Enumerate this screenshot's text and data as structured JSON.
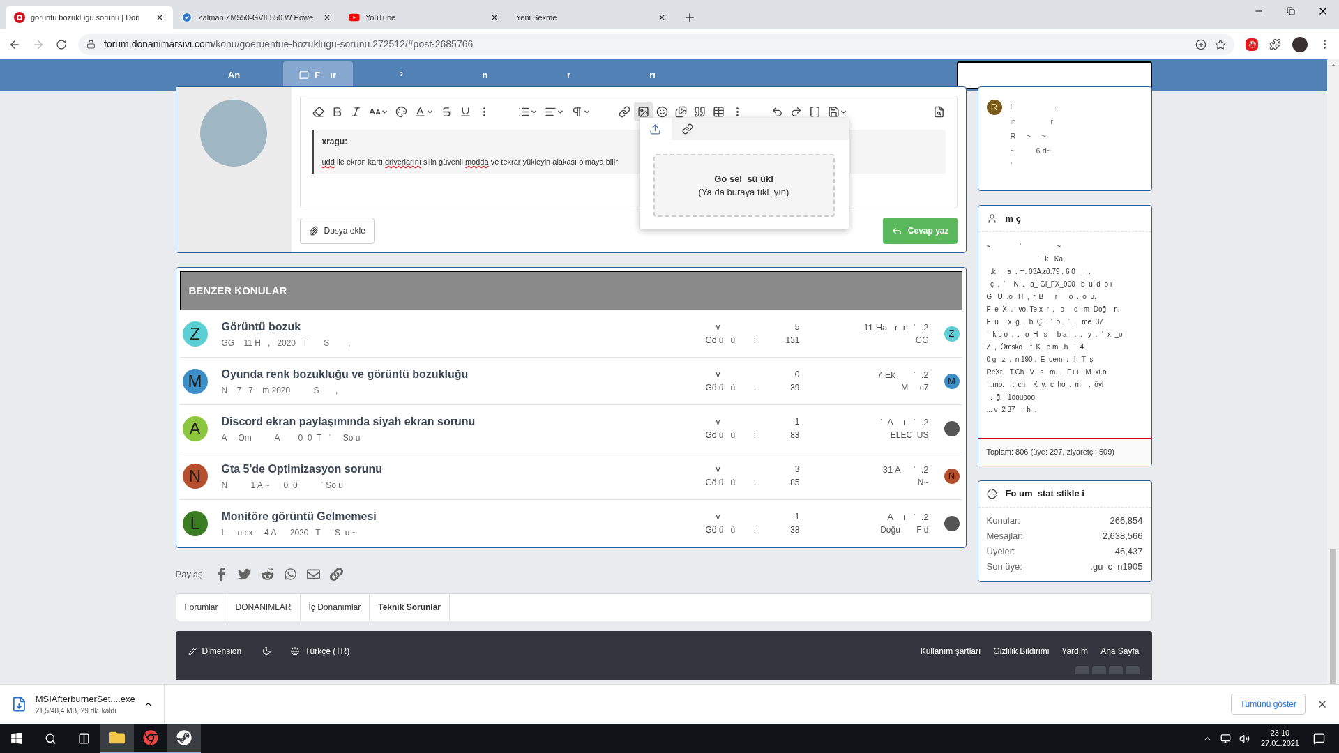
{
  "browser": {
    "tabs": [
      {
        "title": "görüntü bozukluğu sorunu | Don",
        "kind": "site",
        "selected": true
      },
      {
        "title": "Zalman ZM550-GVII 550 W Powe",
        "kind": "check",
        "selected": false
      },
      {
        "title": "YouTube",
        "kind": "video",
        "selected": false
      },
      {
        "title": "Yeni Sekme",
        "kind": "blank",
        "selected": false
      }
    ],
    "url": {
      "host": "forum.donanimarsivi.com",
      "path": "/konu/goeruentue-bozuklugu-sorunu.272512/#post-2685766"
    }
  },
  "nav": {
    "items": [
      {
        "label": "An",
        "selected": false,
        "has_icon": false
      },
      {
        "label": "F    ır",
        "selected": true,
        "has_icon": true
      },
      {
        "label": "ˀ",
        "selected": false,
        "has_icon": false
      },
      {
        "label": "n",
        "selected": false,
        "has_icon": false
      },
      {
        "label": "r",
        "selected": false,
        "has_icon": false
      },
      {
        "label": "rı",
        "selected": false,
        "has_icon": false
      }
    ]
  },
  "editor": {
    "toolbar": [
      {
        "kind": "eraser",
        "selected": false
      },
      {
        "kind": "bold",
        "selected": false
      },
      {
        "kind": "italic",
        "selected": false
      },
      {
        "kind": "size",
        "selected": false
      },
      {
        "kind": "palette",
        "selected": false
      },
      {
        "kind": "color",
        "selected": false
      },
      {
        "kind": "strike",
        "selected": false
      },
      {
        "kind": "underline",
        "selected": false
      },
      {
        "kind": "more",
        "selected": false
      },
      {
        "kind": "list",
        "selected": false
      },
      {
        "kind": "align",
        "selected": false
      },
      {
        "kind": "paragraph",
        "selected": false
      },
      {
        "kind": "link",
        "selected": false
      },
      {
        "kind": "image",
        "selected": true
      },
      {
        "kind": "smile",
        "selected": false
      },
      {
        "kind": "media",
        "selected": false
      },
      {
        "kind": "quote",
        "selected": false
      },
      {
        "kind": "table",
        "selected": false
      },
      {
        "kind": "more",
        "selected": false
      },
      {
        "kind": "undo",
        "selected": false
      },
      {
        "kind": "redo",
        "selected": false
      },
      {
        "kind": "code",
        "selected": false
      },
      {
        "kind": "save",
        "selected": false
      },
      {
        "kind": "preview",
        "selected": false
      }
    ],
    "quote": {
      "author": "xragu:",
      "segments": [
        {
          "text": "udd",
          "misspelled": true
        },
        {
          "text": " ile ekran kartı ",
          "misspelled": false
        },
        {
          "text": "driverlarını",
          "misspelled": true
        },
        {
          "text": " silin güvenli ",
          "misspelled": false
        },
        {
          "text": "modda",
          "misspelled": true
        },
        {
          "text": " ve tekrar yükleyin alakası olmaya bilir",
          "misspelled": false
        }
      ]
    },
    "attach_button": "Dosya ekle",
    "reply_button": "Cevap yaz",
    "popup": {
      "tabs": [
        {
          "kind": "upload",
          "selected": true
        },
        {
          "kind": "link",
          "selected": false
        }
      ],
      "drop_title": "Gö sel  sü ükl",
      "drop_hint": "(Ya da buraya tıkl  yın)"
    }
  },
  "similar": {
    "title": "BENZER KONULAR",
    "rows": [
      {
        "letter": "Z",
        "color": "#5ccfd4",
        "title": "Görüntü bozuk",
        "meta": "GG    11 H   ,   2020   T       S        ,",
        "replies_label": "v",
        "replies": "5",
        "views_label": "Gö ü   ü        :",
        "views": "131",
        "last_date": "11 Ha   r  n  ˈ  .2",
        "last_user": "GG",
        "last_avatar": {
          "kind": "letter",
          "letter": "Z"
        }
      },
      {
        "letter": "M",
        "color": "#3b8fc9",
        "title": "Oyunda renk bozukluğu ve görüntü bozukluğu",
        "meta": "N    7   7    m 2020          S       ,",
        "replies_label": "v",
        "replies": "0",
        "views_label": "Gö ü   ü        :",
        "views": "39",
        "last_date": "7 Ek       ˈ  .2",
        "last_user": "M     c7",
        "last_avatar": {
          "kind": "letter",
          "letter": "M"
        }
      },
      {
        "letter": "A",
        "color": "#8cc63f",
        "title": "Discord ekran paylaşımında siyah ekran sorunu",
        "meta": "A     Om          A        0  0  T   ˈ     So u",
        "replies_label": "v",
        "replies": "1",
        "views_label": "Gö ü   ü        :",
        "views": "83",
        "last_date": "ˈ  A    ı   ˈ  .2",
        "last_user": "ELEC  US",
        "last_avatar": {
          "kind": "photo"
        }
      },
      {
        "letter": "N",
        "color": "#b54f2e",
        "title": "Gta 5'de Optimizasyon sorunu",
        "meta": "N          1 A ~      0  0          ˈ So u",
        "replies_label": "v",
        "replies": "3",
        "views_label": "Gö ü   ü        :",
        "views": "85",
        "last_date": "31 A     ˈ  .2",
        "last_user": "N~",
        "last_avatar": {
          "kind": "letter",
          "letter": "N"
        }
      },
      {
        "letter": "L",
        "color": "#3a7d22",
        "title": "Monitöre görüntü Gelmemesi",
        "meta": "L     o cx     4 A      2020   T    ˈ S  u ~",
        "replies_label": "v",
        "replies": "1",
        "views_label": "Gö ü   ü        :",
        "views": "38",
        "last_date": "A    ı   ˈ  .2",
        "last_user": "Doğu       F d",
        "last_avatar": {
          "kind": "photo"
        }
      }
    ]
  },
  "share": {
    "label": "Paylaş:",
    "items": [
      {
        "kind": "facebook"
      },
      {
        "kind": "twitter"
      },
      {
        "kind": "reddit"
      },
      {
        "kind": "whatsapp"
      },
      {
        "kind": "mail"
      },
      {
        "kind": "link"
      }
    ]
  },
  "breadcrumb": [
    {
      "label": "Forumlar",
      "current": false
    },
    {
      "label": "DONANIMLAR",
      "current": false
    },
    {
      "label": "İç Donanımlar",
      "current": false
    },
    {
      "label": "Teknik Sorunlar",
      "current": true
    }
  ],
  "footer": {
    "style_label": "Dimension",
    "language": "Türkçe (TR)",
    "links": [
      "Kullanım şartları",
      "Gizlilik Bildirimi",
      "Yardım",
      "Ana Sayfa"
    ]
  },
  "sidebar": {
    "activity": {
      "letter": "R",
      "lines": [
        "i                    .",
        "ir                 r",
        "R     ~     ~",
        "~          6 d~",
        "ˈ"
      ]
    },
    "online": {
      "title": "m ç",
      "lines": [
        "~               ˈ                  ~",
        "                          ˈ   k   Ka",
        "  .k  _  a  . m. 03A.ε0.79 . 6 0 _ ,  .",
        "  ç  ,  ˈ    N  .   a_ Gi_FX_900   b  u  d  o ı",
        "G   U  .o   H  ,  r. B      r      o  .  o  u.",
        "F  e  X  .   vo. Te x  r  ,   o     d   m  Doğ    n.",
        "F  u     x  g  ,  b  Ç ˈ  ˈ  o .  ˈ  .   me  37",
        "ˈ  k u o  ,  .  .o  H   s     b a    .  .   y  .  ˈ  x  _o",
        "Z  ,  Ömsko    t  K   e m  .h   ˈ  4",
        "0 g   z  .  n.190 .  E  uem  .  .h  T  ş",
        "ReXr.   T.Ch   V   s   m. .   E++   M  xt.o",
        "ˈ .mo.    t  ch    K  y.  c  ho  .  m    .  öyl",
        "  .  ğ.   1douooo",
        "... v  2 37   .  h  ."
      ],
      "total": "Toplam: 806 (üye: 297, ziyaretçi: 509)"
    },
    "stats": {
      "title": "Fo um  stat stikle i",
      "rows": [
        {
          "label": "Konular:",
          "value": "266,854"
        },
        {
          "label": "Mesajlar:",
          "value": "2,638,566"
        },
        {
          "label": "Üyeler:",
          "value": "46,437"
        },
        {
          "label": "Son üye:",
          "value": ".gu  c  n1905"
        }
      ]
    }
  },
  "download": {
    "file": "MSIAfterburnerSet....exe",
    "progress": "21,5/48,4 MB, 29 dk. kaldı",
    "show_all": "Tümünü göster"
  },
  "taskbar": {
    "apps": [
      {
        "kind": "explorer",
        "selected": true
      },
      {
        "kind": "chrome",
        "selected": false
      },
      {
        "kind": "steam",
        "selected": true
      }
    ],
    "time": "23:10",
    "date": "27.01.2021"
  }
}
